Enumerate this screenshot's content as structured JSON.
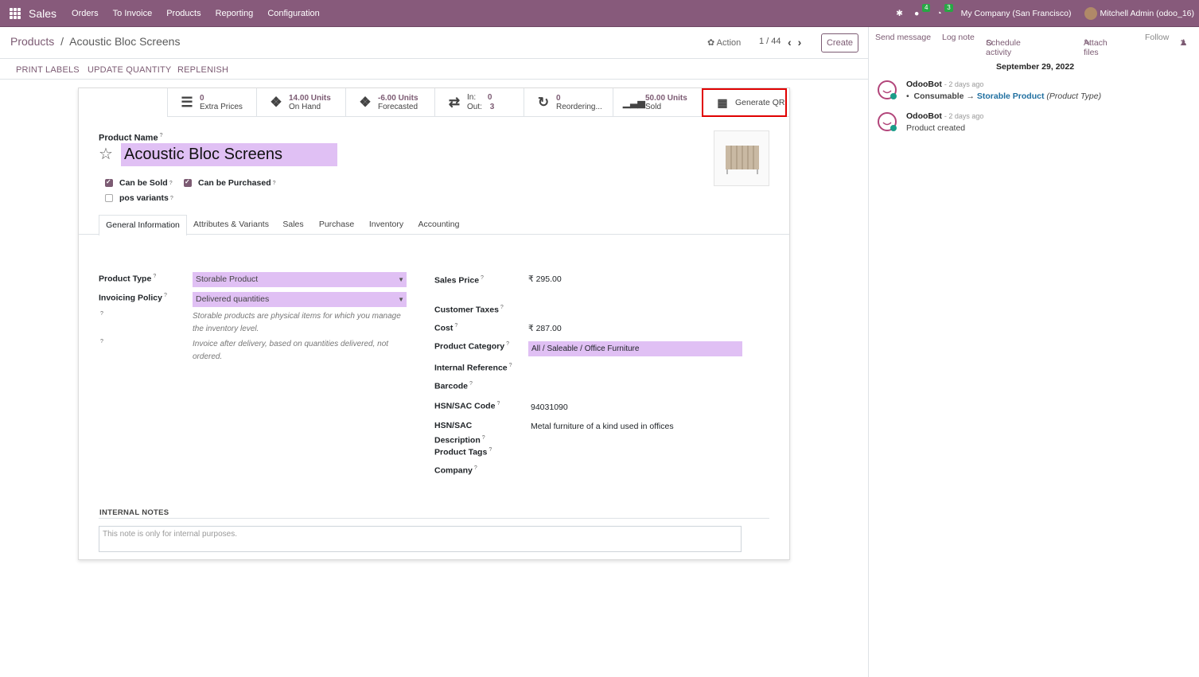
{
  "topbar": {
    "app_name": "Sales",
    "menu": [
      "Orders",
      "To Invoice",
      "Products",
      "Reporting",
      "Configuration"
    ],
    "chat_count": "4",
    "activity_count": "3",
    "company": "My Company (San Francisco)",
    "user": "Mitchell Admin (odoo_16)"
  },
  "control_panel": {
    "breadcrumb_parent": "Products",
    "breadcrumb_sep": "/",
    "breadcrumb_current": "Acoustic Bloc Screens",
    "action_label": "Action",
    "pager": "1 / 44",
    "create_label": "Create"
  },
  "statusbar": {
    "buttons": [
      "PRINT LABELS",
      "UPDATE QUANTITY",
      "REPLENISH"
    ]
  },
  "smart_buttons": {
    "extra_prices": {
      "value": "0",
      "label": "Extra Prices"
    },
    "on_hand": {
      "value": "14.00 Units",
      "label": "On Hand"
    },
    "forecasted": {
      "value": "-6.00 Units",
      "label": "Forecasted"
    },
    "in_out": {
      "in_label": "In:",
      "in_value": "0",
      "out_label": "Out:",
      "out_value": "3"
    },
    "reordering": {
      "value": "0",
      "label": "Reordering..."
    },
    "sold": {
      "value": "50.00 Units",
      "label": "Sold"
    },
    "generate_qr": "Generate QR"
  },
  "product": {
    "name_label": "Product Name",
    "name": "Acoustic Bloc Screens",
    "can_be_sold": "Can be Sold",
    "can_be_purchased": "Can be Purchased",
    "pos_variants": "pos variants"
  },
  "tabs": [
    "General Information",
    "Attributes & Variants",
    "Sales",
    "Purchase",
    "Inventory",
    "Accounting"
  ],
  "general": {
    "product_type_label": "Product Type",
    "product_type": "Storable Product",
    "invoicing_policy_label": "Invoicing Policy",
    "invoicing_policy": "Delivered quantities",
    "help_type": "Storable products are physical items for which you manage the inventory level.",
    "help_invoice": "Invoice after delivery, based on quantities delivered, not ordered.",
    "sales_price_label": "Sales Price",
    "sales_price": "₹ 295.00",
    "customer_taxes_label": "Customer Taxes",
    "cost_label": "Cost",
    "cost": "₹ 287.00",
    "category_label": "Product Category",
    "category": "All / Saleable / Office Furniture",
    "internal_ref_label": "Internal Reference",
    "barcode_label": "Barcode",
    "hsn_label": "HSN/SAC Code",
    "hsn": "94031090",
    "hsn_desc_label_1": "HSN/SAC",
    "hsn_desc_label_2": "Description",
    "hsn_desc": "Metal furniture of a kind used in offices",
    "tags_label": "Product Tags",
    "company_label": "Company"
  },
  "notes": {
    "label": "INTERNAL NOTES",
    "placeholder": "This note is only for internal purposes."
  },
  "chatter": {
    "send_message": "Send message",
    "log_note": "Log note",
    "schedule_activity": "Schedule activity",
    "attach_files": "Attach files",
    "follow": "Follow",
    "followers": "1",
    "date": "September 29, 2022",
    "messages": [
      {
        "author": "OdooBot",
        "time": "- 2 days ago",
        "old": "Consumable",
        "new": "Storable Product",
        "field": "(Product Type)"
      },
      {
        "author": "OdooBot",
        "time": "- 2 days ago",
        "body": "Product created"
      }
    ]
  },
  "colors": {
    "brand": "#875a7b",
    "accent": "#7c5b73",
    "highlight": "#e0c0f4",
    "qr_border": "#e00000"
  }
}
